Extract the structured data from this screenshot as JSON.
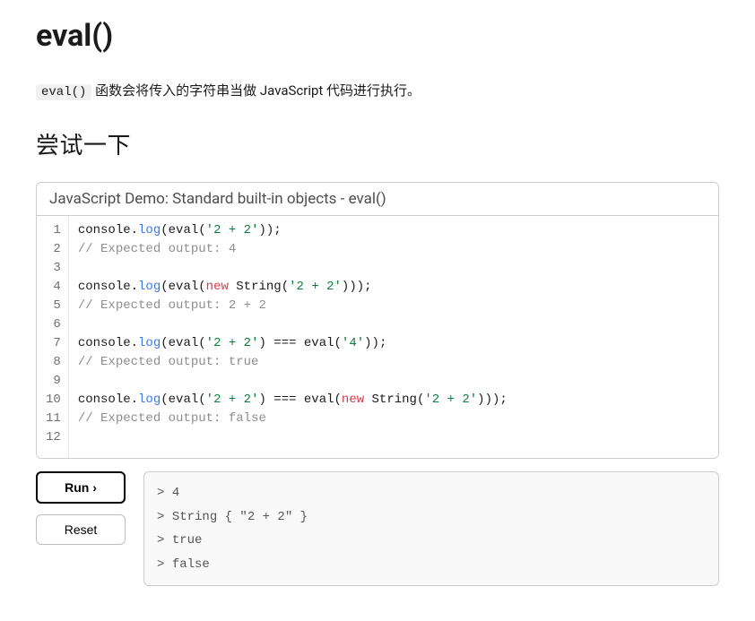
{
  "page": {
    "title": "eval()",
    "intro_code": "eval()",
    "intro_rest": " 函数会将传入的字符串当做 JavaScript 代码进行执行。",
    "try_heading": "尝试一下"
  },
  "demo": {
    "title": "JavaScript Demo: Standard built-in objects - eval()",
    "line_count": 12,
    "code_lines": [
      [
        {
          "t": "id",
          "v": "console"
        },
        {
          "t": "pun",
          "v": "."
        },
        {
          "t": "prop",
          "v": "log"
        },
        {
          "t": "pun",
          "v": "("
        },
        {
          "t": "id",
          "v": "eval"
        },
        {
          "t": "pun",
          "v": "("
        },
        {
          "t": "str",
          "v": "'2 + 2'"
        },
        {
          "t": "pun",
          "v": "));"
        }
      ],
      [
        {
          "t": "cmt",
          "v": "// Expected output: 4"
        }
      ],
      [],
      [
        {
          "t": "id",
          "v": "console"
        },
        {
          "t": "pun",
          "v": "."
        },
        {
          "t": "prop",
          "v": "log"
        },
        {
          "t": "pun",
          "v": "("
        },
        {
          "t": "id",
          "v": "eval"
        },
        {
          "t": "pun",
          "v": "("
        },
        {
          "t": "new",
          "v": "new "
        },
        {
          "t": "id",
          "v": "String"
        },
        {
          "t": "pun",
          "v": "("
        },
        {
          "t": "str",
          "v": "'2 + 2'"
        },
        {
          "t": "pun",
          "v": ")));"
        }
      ],
      [
        {
          "t": "cmt",
          "v": "// Expected output: 2 + 2"
        }
      ],
      [],
      [
        {
          "t": "id",
          "v": "console"
        },
        {
          "t": "pun",
          "v": "."
        },
        {
          "t": "prop",
          "v": "log"
        },
        {
          "t": "pun",
          "v": "("
        },
        {
          "t": "id",
          "v": "eval"
        },
        {
          "t": "pun",
          "v": "("
        },
        {
          "t": "str",
          "v": "'2 + 2'"
        },
        {
          "t": "pun",
          "v": ") === "
        },
        {
          "t": "id",
          "v": "eval"
        },
        {
          "t": "pun",
          "v": "("
        },
        {
          "t": "str",
          "v": "'4'"
        },
        {
          "t": "pun",
          "v": "));"
        }
      ],
      [
        {
          "t": "cmt",
          "v": "// Expected output: true"
        }
      ],
      [],
      [
        {
          "t": "id",
          "v": "console"
        },
        {
          "t": "pun",
          "v": "."
        },
        {
          "t": "prop",
          "v": "log"
        },
        {
          "t": "pun",
          "v": "("
        },
        {
          "t": "id",
          "v": "eval"
        },
        {
          "t": "pun",
          "v": "("
        },
        {
          "t": "str",
          "v": "'2 + 2'"
        },
        {
          "t": "pun",
          "v": ") === "
        },
        {
          "t": "id",
          "v": "eval"
        },
        {
          "t": "pun",
          "v": "("
        },
        {
          "t": "new",
          "v": "new "
        },
        {
          "t": "id",
          "v": "String"
        },
        {
          "t": "pun",
          "v": "("
        },
        {
          "t": "str",
          "v": "'2 + 2'"
        },
        {
          "t": "pun",
          "v": ")));"
        }
      ],
      [
        {
          "t": "cmt",
          "v": "// Expected output: false"
        }
      ],
      []
    ]
  },
  "buttons": {
    "run": "Run ›",
    "reset": "Reset"
  },
  "output": [
    "4",
    "String { \"2 + 2\" }",
    "true",
    "false"
  ]
}
